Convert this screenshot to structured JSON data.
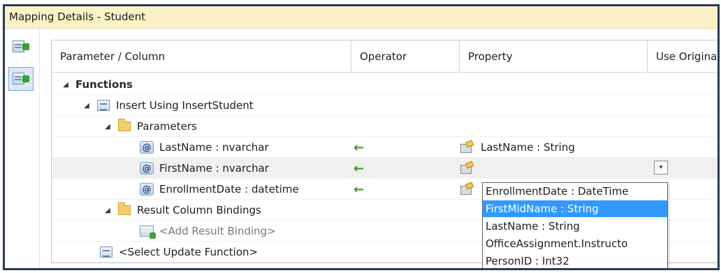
{
  "window": {
    "title": "Mapping Details - Student"
  },
  "left_toolbar": {
    "buttons": [
      {
        "icon": "map-table-icon"
      },
      {
        "icon": "map-functions-icon",
        "selected": true
      }
    ]
  },
  "grid": {
    "columns": [
      "Parameter / Column",
      "Operator",
      "Property",
      "Use Origina"
    ],
    "rows": {
      "functions": {
        "label": "Functions",
        "expanded": true
      },
      "insert": {
        "label": "Insert Using InsertStudent",
        "expanded": true
      },
      "parameters": {
        "label": "Parameters",
        "expanded": true
      },
      "param_lastname": {
        "label": "LastName : nvarchar",
        "operator": "←",
        "property": "LastName : String"
      },
      "param_firstname": {
        "label": "FirstName : nvarchar",
        "operator": "←",
        "property": ""
      },
      "param_enrollment": {
        "label": "EnrollmentDate : datetime",
        "operator": "←",
        "property": ""
      },
      "result_bindings": {
        "label": "Result Column Bindings",
        "expanded": true
      },
      "add_result": {
        "label": "<Add Result Binding>"
      },
      "select_update": {
        "label": "<Select Update Function>"
      }
    },
    "dropdown_glyph": "▾",
    "dropdown_options": [
      "EnrollmentDate : DateTime",
      "FirstMidName : String",
      "LastName : String",
      "OfficeAssignment.Instructo",
      "PersonID : Int32"
    ],
    "dropdown_highlighted_index": 1
  },
  "colors": {
    "title_bar_bg": "#fbf1c6",
    "frame_border": "#2b3a55",
    "highlight": "#3399ff",
    "arrow_green": "#3b9a1e"
  }
}
